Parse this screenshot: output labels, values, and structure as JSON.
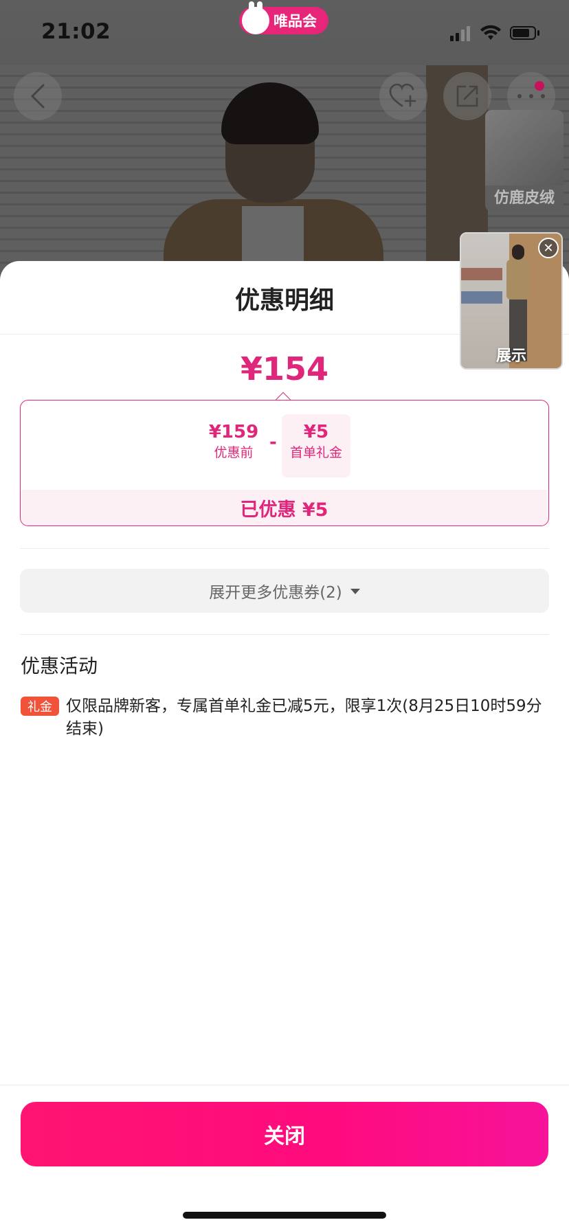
{
  "status_bar": {
    "time": "21:02",
    "brand": "唯品会"
  },
  "product_bg": {
    "thumb_label": "仿鹿皮绒"
  },
  "sheet": {
    "title": "优惠明细",
    "final_price": "¥154",
    "breakdown": {
      "original_amount": "¥159",
      "original_label": "优惠前",
      "operator": "-",
      "discount_amount": "¥5",
      "discount_label": "首单礼金",
      "saved_text": "已优惠 ¥5"
    },
    "expand_label": "展开更多优惠券(2)",
    "activity_title": "优惠活动",
    "activities": [
      {
        "badge": "礼金",
        "text": "仅限品牌新客，专属首单礼金已减5元，限享1次(8月25日10时59分结束)"
      }
    ]
  },
  "floating_video": {
    "label": "展示",
    "close_symbol": "✕"
  },
  "footer": {
    "close_label": "关闭"
  },
  "colors": {
    "accent": "#e0267a",
    "button": "#ff1471",
    "badge": "#f0533a"
  },
  "icons": {
    "back": "back-arrow-icon",
    "favorite": "heart-plus-icon",
    "share": "share-icon",
    "more": "more-dots-icon",
    "signal": "signal-icon",
    "wifi": "wifi-icon",
    "battery": "battery-icon"
  }
}
